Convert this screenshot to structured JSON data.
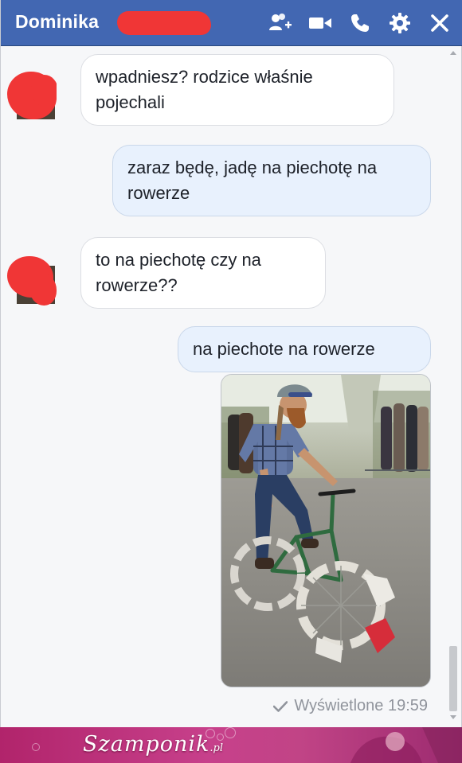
{
  "header": {
    "contact_name": "Dominika",
    "background_color": "#4267b2",
    "icons": [
      "add-people-icon",
      "video-call-icon",
      "phone-call-icon",
      "gear-icon",
      "close-icon"
    ]
  },
  "messages": [
    {
      "direction": "incoming",
      "text": "wpadniesz? rodzice właśnie pojechali"
    },
    {
      "direction": "outgoing",
      "text": "zaraz będę, jadę na piechotę na rowerze"
    },
    {
      "direction": "incoming",
      "text": "to na piechotę czy na rowerze??"
    },
    {
      "direction": "outgoing",
      "text": "na piechote na rowerze"
    },
    {
      "direction": "outgoing",
      "type": "photo",
      "subject": "bearded cyclist in helmet riding a bike with shoes attached to the wheels"
    }
  ],
  "status": {
    "seen_label": "Wyświetlone 19:59",
    "icon": "checkmark-icon"
  },
  "footer": {
    "logo_text": "Szamponik",
    "logo_suffix": ".pl"
  }
}
